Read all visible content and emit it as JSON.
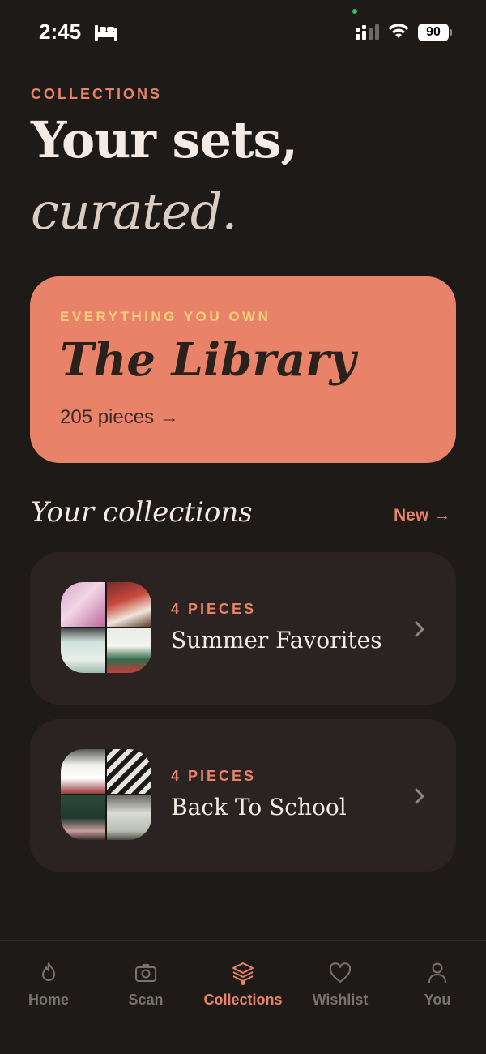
{
  "status_bar": {
    "time": "2:45",
    "battery": "90"
  },
  "header": {
    "eyebrow": "COLLECTIONS",
    "headline_line1": "Your sets,",
    "headline_line2": "curated."
  },
  "library_card": {
    "eyebrow": "EVERYTHING YOU OWN",
    "title": "The Library",
    "count": "205 pieces →"
  },
  "section": {
    "title": "Your collections",
    "new_link": "New →"
  },
  "collections": [
    {
      "count_label": "4 PIECES",
      "name": "Summer Favorites"
    },
    {
      "count_label": "4 PIECES",
      "name": "Back To School"
    }
  ],
  "nav": {
    "items": [
      {
        "label": "Home",
        "icon": "flame-icon"
      },
      {
        "label": "Scan",
        "icon": "camera-icon"
      },
      {
        "label": "Collections",
        "icon": "layers-icon",
        "active": true
      },
      {
        "label": "Wishlist",
        "icon": "heart-icon"
      },
      {
        "label": "You",
        "icon": "person-icon"
      }
    ]
  },
  "colors": {
    "background": "#1e1a18",
    "accent": "#e8836a",
    "card": "#2a2321",
    "gold": "#f7d07a"
  }
}
